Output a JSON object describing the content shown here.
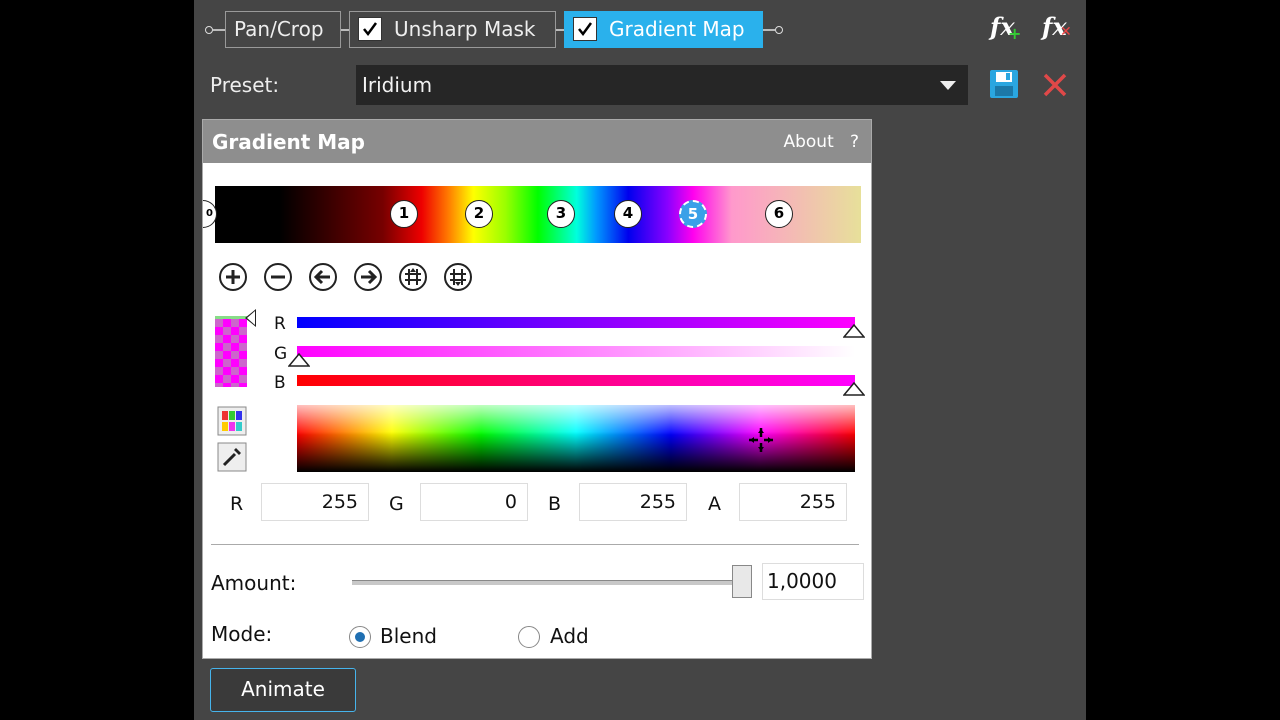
{
  "chain": {
    "items": [
      {
        "label": "Pan/Crop",
        "checkbox": false,
        "active": false
      },
      {
        "label": "Unsharp Mask",
        "checkbox": true,
        "checked": true,
        "active": false
      },
      {
        "label": "Gradient Map",
        "checkbox": true,
        "checked": true,
        "active": true
      }
    ],
    "fx_add_icon": "fx-add-icon",
    "fx_remove_icon": "fx-remove-icon"
  },
  "preset": {
    "label": "Preset:",
    "value": "Iridium"
  },
  "dialog": {
    "title": "Gradient Map",
    "about": "About",
    "help": "?",
    "gradient_stops": [
      "0",
      "1",
      "2",
      "3",
      "4",
      "5",
      "6"
    ],
    "selected_stop": "5",
    "channels": {
      "r": "R",
      "g": "G",
      "b": "B"
    },
    "rgba": {
      "r_label": "R",
      "r_value": "255",
      "g_label": "G",
      "g_value": "0",
      "b_label": "B",
      "b_value": "255",
      "a_label": "A",
      "a_value": "255"
    },
    "amount": {
      "label": "Amount:",
      "value": "1,0000",
      "level": 1.0
    },
    "mode": {
      "label": "Mode:",
      "options": [
        "Blend",
        "Add"
      ],
      "selected": "Blend"
    }
  },
  "animate_button": "Animate",
  "colors": {
    "panel_bg": "#454545",
    "accent": "#2ab1ec",
    "selected_color": "#ff00ff"
  }
}
